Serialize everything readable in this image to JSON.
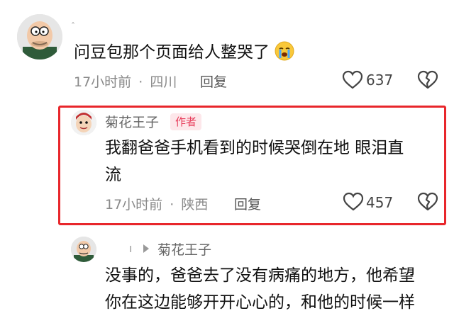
{
  "comment": {
    "text": "问豆包那个页面给人整哭了",
    "emoji_icon": "crying-face-icon",
    "time": "17小时前",
    "dot": "·",
    "location": "四川",
    "reply_label": "回复",
    "likes": "637"
  },
  "reply": {
    "username": "菊花王子",
    "badge": "作者",
    "text_line1": "我翻爸爸手机看到的时候哭倒在地 眼泪直",
    "text_line2": "流",
    "time": "17小时前",
    "dot": "·",
    "location": "陕西",
    "reply_label": "回复",
    "likes": "457"
  },
  "sub_reply": {
    "arrow": "›",
    "username": "菊花王子",
    "text_line1": "没事的，爸爸去了没有病痛的地方，他希望",
    "text_line2": "你在这边能够开开心心的，和他的时候一样"
  },
  "colors": {
    "highlight_border": "#e8262b",
    "badge_bg": "#fde7ea",
    "badge_text": "#e73c5a"
  }
}
